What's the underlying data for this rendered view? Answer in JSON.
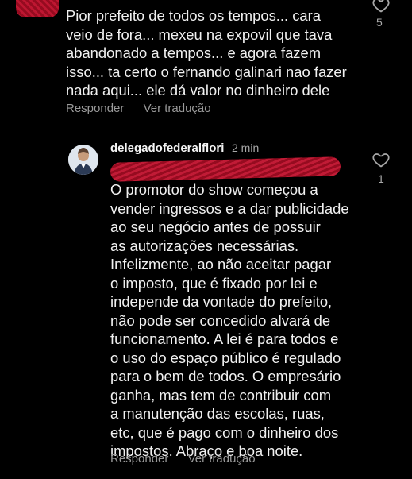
{
  "comments": [
    {
      "text": "Pior prefeito de todos os tempos... cara\nveio de fora... mexeu na expovil que tava\nabandonado a tempos... e agora fazem\nisso... ta certo o fernando galinari nao fazer\nnada aqui... ele dá valor no dinheiro dele",
      "likes": "5",
      "reply_label": "Responder",
      "translate_label": "Ver tradução"
    },
    {
      "username": "delegadofederalflori",
      "time": "2 min",
      "text": "O promotor do show começou a\nvender ingressos e a dar publicidade\nao seu negócio antes de possuir\nas autorizações necessárias.\nInfelizmente, ao não aceitar pagar\no imposto, que é fixado por lei e\nindepende da vontade do prefeito,\nnão pode ser concedido alvará de\nfuncionamento. A lei é para todos e\no uso do espaço público é regulado\npara o bem de todos. O empresário\nganha, mas tem de contribuir com\na manutenção das escolas, ruas,\netc, que é pago com o dinheiro dos\nimpostos. Abraço e boa noite.",
      "likes": "1",
      "reply_label": "Responder",
      "translate_label": "Ver tradução"
    }
  ],
  "icons": {
    "like": "heart-outline-icon",
    "redaction": "red-scribble-redaction"
  },
  "colors": {
    "background": "#000000",
    "text": "#f0f0f0",
    "muted": "#9a9a9a",
    "redaction": "#c8102e"
  }
}
